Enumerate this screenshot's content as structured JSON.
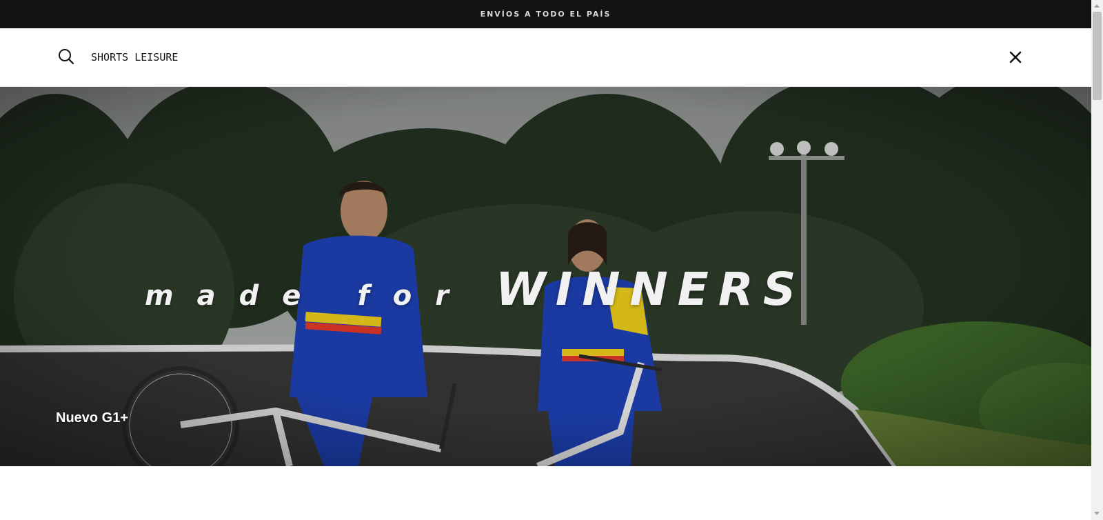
{
  "announcement": {
    "text": "ENVÍOS A TODO EL PAÍS"
  },
  "search": {
    "value": "SHORTS LEISURE",
    "icon": "search-icon",
    "close_icon": "close-icon"
  },
  "hero": {
    "slogan_thin": "made for",
    "slogan_bold": "WINNERS",
    "caption": "Nuevo G1+"
  },
  "colors": {
    "topbar": "#121212",
    "background": "#ffffff"
  }
}
